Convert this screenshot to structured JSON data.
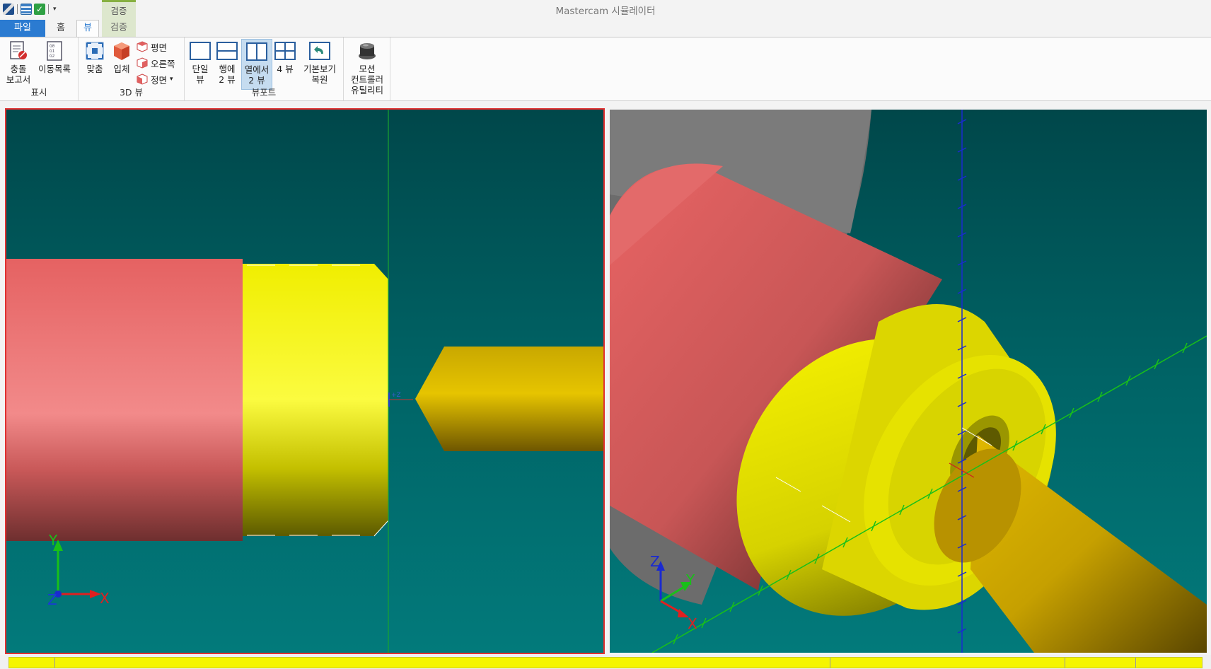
{
  "window": {
    "title": "Mastercam 시뮬레이터",
    "context_group": "검증"
  },
  "quick_access": [
    "app-icon",
    "layers-icon",
    "check-icon"
  ],
  "tabs": {
    "file": "파일",
    "home": "홈",
    "view": "뷰",
    "verify": "검증"
  },
  "ribbon": {
    "groups": {
      "display": "표시",
      "view3d": "3D 뷰",
      "viewport": "뷰포트",
      "motion": ""
    },
    "buttons": {
      "collision_report_l1": "충돌",
      "collision_report_l2": "보고서",
      "move_list": "이동목록",
      "fit": "맞춤",
      "solid": "입체",
      "plane": "평면",
      "right": "오른쪽",
      "front": "정면",
      "single_view_l1": "단일",
      "single_view_l2": "뷰",
      "row_2view_l1": "행에",
      "row_2view_l2": "2 뷰",
      "col_2view_l1": "열에서",
      "col_2view_l2": "2 뷰",
      "four_view": "4 뷰",
      "restore_view_l1": "기본보기",
      "restore_view_l2": "복원",
      "motion_l1": "모션",
      "motion_l2": "컨트롤러",
      "motion_l3": "유틸리티"
    }
  },
  "viewports": {
    "left": {
      "axis_y": "Y",
      "axis_z": "Z",
      "axis_x": "X",
      "origin_label": "+Z"
    },
    "right": {
      "axis_z": "Z",
      "axis_y": "Y",
      "axis_x": "X"
    }
  },
  "colors": {
    "background_top": "#00474a",
    "background_bottom": "#027a7b",
    "stock_red": "#e86767",
    "part_yellow": "#f5f500",
    "tool_gold": "#d4b000",
    "chuck_gray": "#6e6e6e",
    "active_border": "#e03030",
    "file_tab": "#2b7bd1",
    "status_yellow": "#f5f500"
  }
}
